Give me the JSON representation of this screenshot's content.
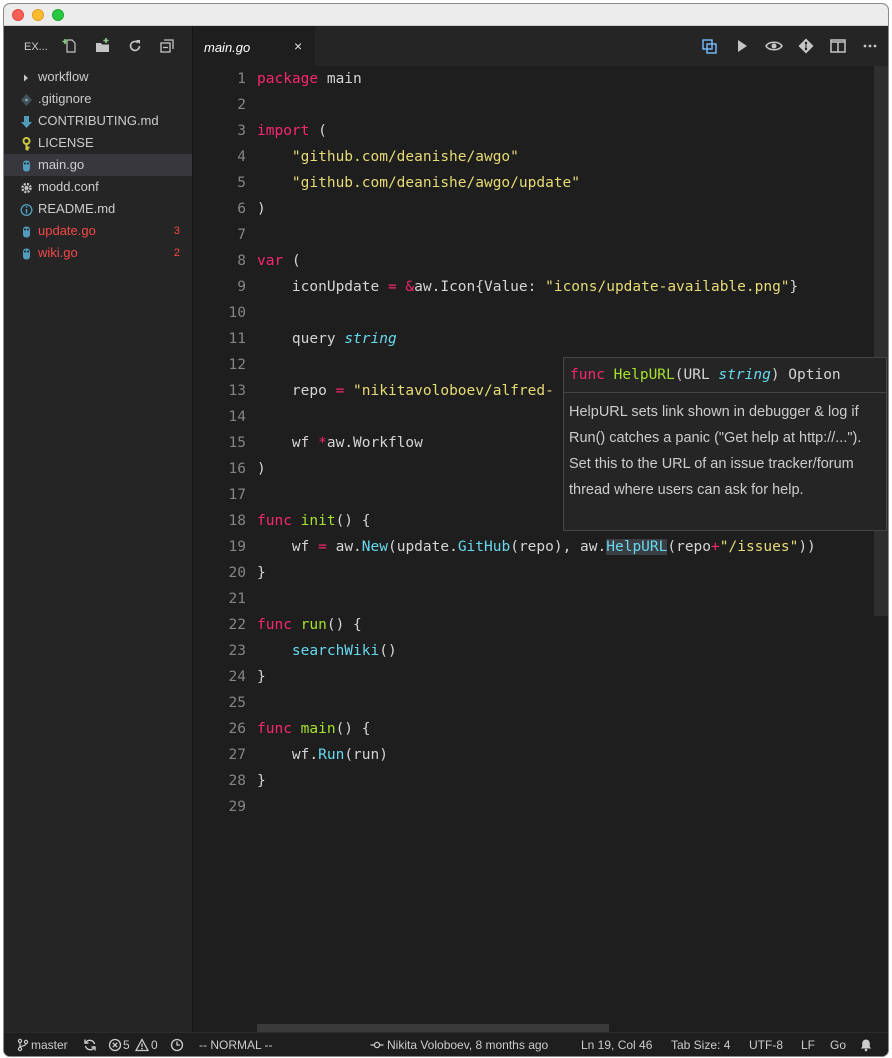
{
  "sidebar": {
    "title": "EX...",
    "actions": [
      "new-file-icon",
      "new-folder-icon",
      "refresh-icon",
      "collapse-all-icon"
    ],
    "items": [
      {
        "label": "workflow",
        "icon": "chevron-right-icon"
      },
      {
        "label": ".gitignore",
        "icon": "git-icon"
      },
      {
        "label": "CONTRIBUTING.md",
        "icon": "download-arrow-icon"
      },
      {
        "label": "LICENSE",
        "icon": "key-icon"
      },
      {
        "label": "main.go",
        "icon": "go-gopher-icon"
      },
      {
        "label": "modd.conf",
        "icon": "gear-icon"
      },
      {
        "label": "README.md",
        "icon": "info-icon"
      },
      {
        "label": "update.go",
        "icon": "go-gopher-icon",
        "badge": "3"
      },
      {
        "label": "wiki.go",
        "icon": "go-gopher-icon",
        "badge": "2"
      }
    ]
  },
  "tabs": {
    "active_label": "main.go",
    "close_glyph": "×",
    "actions": [
      "compare-icon",
      "run-icon",
      "toggle-preview-icon",
      "git-diff-icon",
      "split-editor-icon",
      "more-icon"
    ]
  },
  "editor": {
    "line_numbers": [
      "1",
      "2",
      "3",
      "4",
      "5",
      "6",
      "7",
      "8",
      "9",
      "10",
      "11",
      "12",
      "13",
      "14",
      "15",
      "16",
      "17",
      "18",
      "19",
      "20",
      "21",
      "22",
      "23",
      "24",
      "25",
      "26",
      "27",
      "28",
      "29"
    ],
    "lines": {
      "l1_kw": "package",
      "l1_rest": " main",
      "l3_kw": "import",
      "l3_rest": " (",
      "l4_str": "\"github.com/deanishe/awgo\"",
      "l5_str": "\"github.com/deanishe/awgo/update\"",
      "l6": ")",
      "l8_kw": "var",
      "l8_rest": " (",
      "l9_a": "iconUpdate ",
      "l9_op": "= &",
      "l9_b": "aw.Icon{Value: ",
      "l9_str": "\"icons/update-available.png\"",
      "l9_c": "}",
      "l11_a": "query ",
      "l11_typ": "string",
      "l13_a": "repo ",
      "l13_op": "=",
      "l13_sp": " ",
      "l13_str": "\"nikitavoloboev/alfred-",
      "l15_a": "wf ",
      "l15_op": "*",
      "l15_b": "aw.Workflow",
      "l16": ")",
      "l18_kw": "func",
      "l18_sp": " ",
      "l18_fn": "init",
      "l18_rest": "() {",
      "l19_a": "wf ",
      "l19_op": "=",
      "l19_b": " aw.",
      "l19_c1": "New",
      "l19_c": "(update.",
      "l19_c2": "GitHub",
      "l19_d": "(repo), aw.",
      "l19_c3": "HelpURL",
      "l19_e": "(repo",
      "l19_op2": "+",
      "l19_str": "\"/issues\"",
      "l19_f": "))",
      "l20": "}",
      "l22_kw": "func",
      "l22_sp": " ",
      "l22_fn": "run",
      "l22_rest": "() {",
      "l23_c": "searchWiki",
      "l23_rest": "()",
      "l24": "}",
      "l26_kw": "func",
      "l26_sp": " ",
      "l26_fn": "main",
      "l26_rest": "() {",
      "l27_a": "wf.",
      "l27_c": "Run",
      "l27_rest": "(run)",
      "l28": "}"
    }
  },
  "hover": {
    "sig_kw": "func",
    "sig_sp": " ",
    "sig_name": "HelpURL",
    "sig_open": "(URL ",
    "sig_type": "string",
    "sig_close": ") Option",
    "doc": "HelpURL sets link shown in debugger & log if Run() catches a panic (\"Get help at http://...\"). Set this to the URL of an issue tracker/forum thread where users can ask for help."
  },
  "statusbar": {
    "branch": "master",
    "errors": "5",
    "warnings": "0",
    "mode": "-- NORMAL --",
    "blame": "Nikita Voloboev, 8 months ago",
    "position": "Ln 19, Col 46",
    "tab_size": "Tab Size: 4",
    "encoding": "UTF-8",
    "eol": "LF",
    "language": "Go"
  },
  "colors": {
    "keyword": "#f92672",
    "function": "#a6e22e",
    "string": "#e6db74",
    "type": "#66d9ef",
    "modified": "#f44747"
  }
}
